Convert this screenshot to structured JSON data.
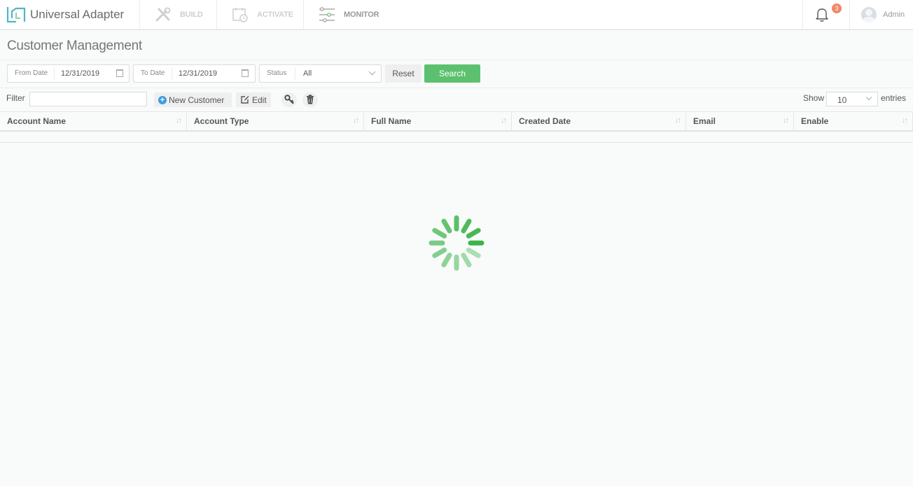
{
  "app": {
    "name": "Universal Adapter"
  },
  "nav": {
    "tabs": [
      {
        "label": "BUILD",
        "icon": "tools-icon",
        "state": "dim"
      },
      {
        "label": "ACTIVATE",
        "icon": "calendar-clock-icon",
        "state": "dim"
      },
      {
        "label": "MONITOR",
        "icon": "sliders-icon",
        "state": "active"
      }
    ],
    "notifications_count": "3",
    "user_name": "Admin"
  },
  "page": {
    "title": "Customer Management"
  },
  "filters": {
    "from_date_label": "From Date",
    "from_date_value": "12/31/2019",
    "to_date_label": "To Date",
    "to_date_value": "12/31/2019",
    "status_label": "Status",
    "status_value": "All",
    "reset_label": "Reset",
    "search_label": "Search"
  },
  "toolbar": {
    "filter_label": "Filter",
    "filter_value": "",
    "new_customer_label": "New Customer",
    "edit_label": "Edit",
    "show_label": "Show",
    "show_value": "10",
    "entries_label": "entries"
  },
  "table": {
    "columns": [
      "Account Name",
      "Account Type",
      "Full Name",
      "Created Date",
      "Email",
      "Enable"
    ],
    "rows": []
  },
  "loading": {
    "spinner_color": "#3cb44a"
  },
  "colors": {
    "accent": "#5cc16f",
    "badge": "#f0876b",
    "info": "#3d9fe0"
  }
}
